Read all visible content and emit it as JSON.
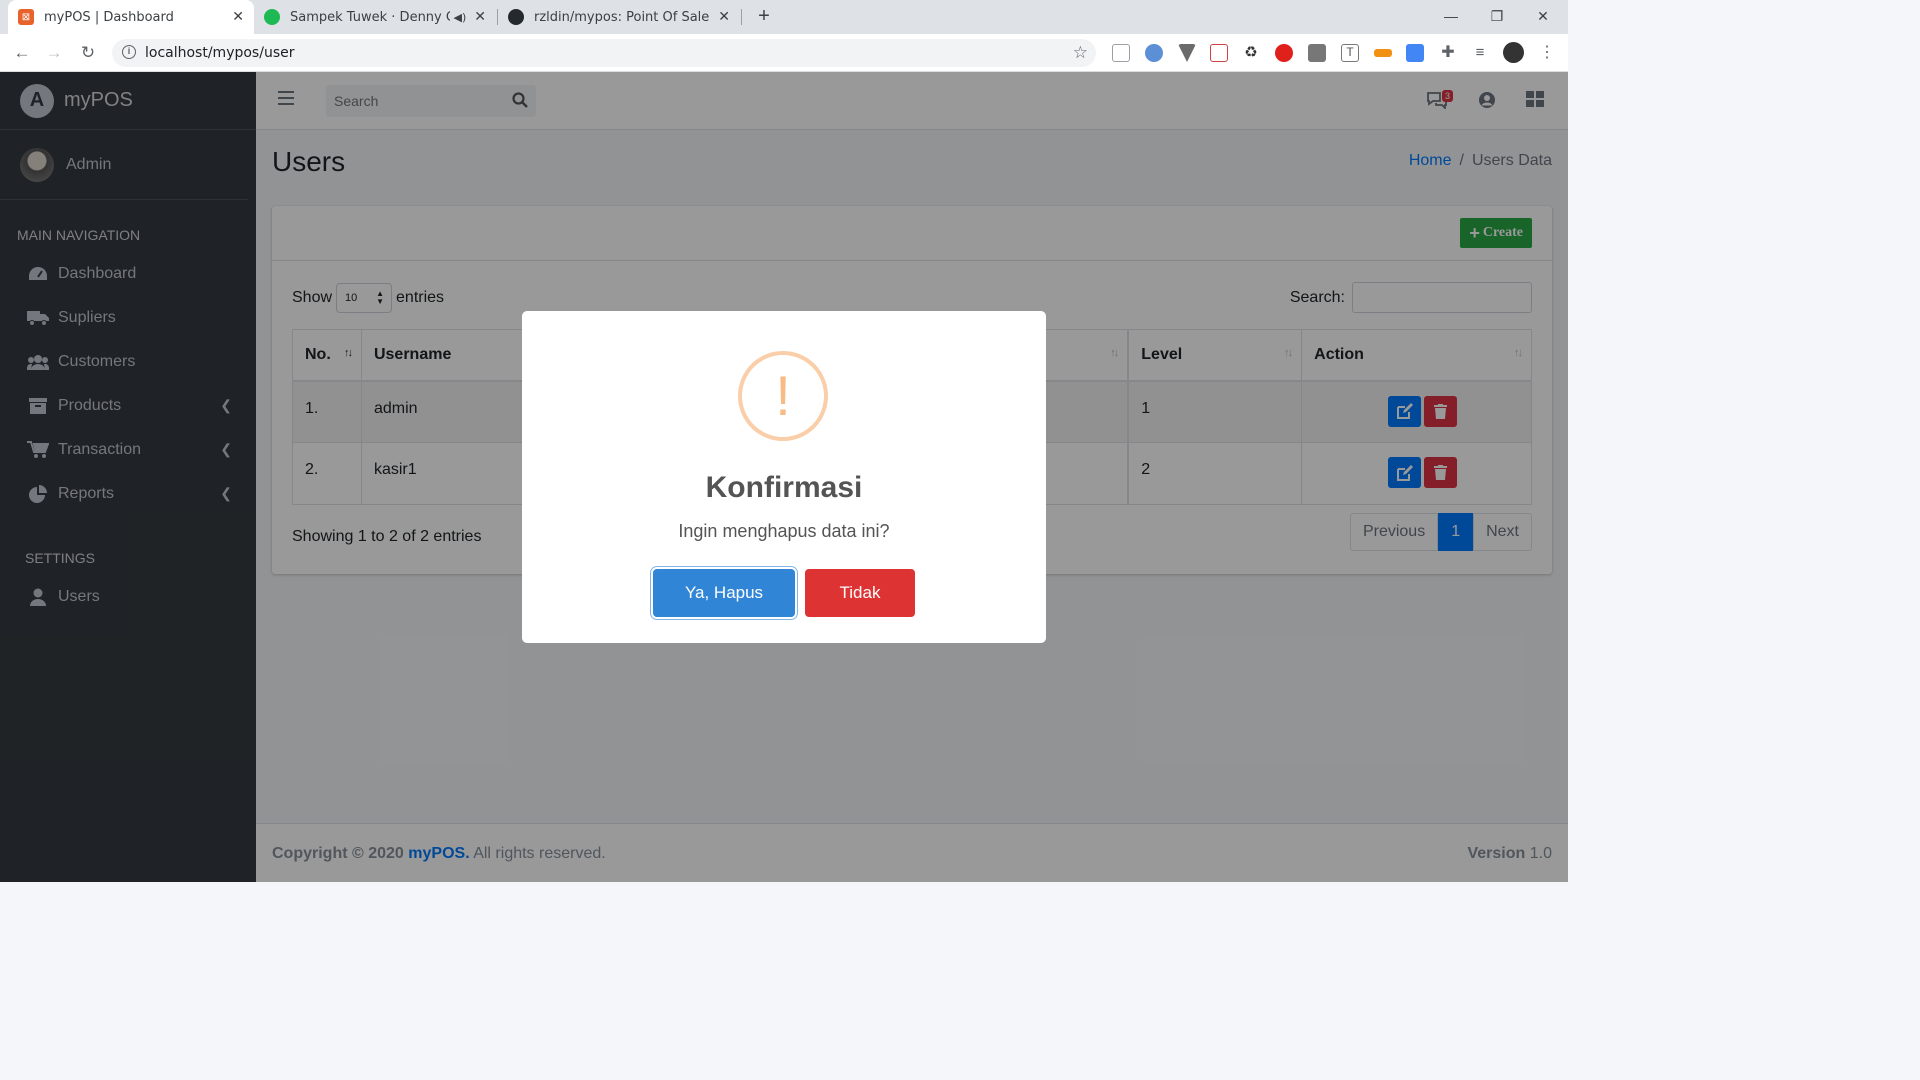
{
  "browser": {
    "tabs": [
      {
        "title": "myPOS | Dashboard",
        "active": true
      },
      {
        "title": "Sampek Tuwek · Denny Cakn",
        "active": false
      },
      {
        "title": "rzldin/mypos: Point Of Sale Appli",
        "active": false
      }
    ],
    "url": "localhost/mypos/user"
  },
  "sidebar": {
    "brand": "myPOS",
    "user": "Admin",
    "main_header": "MAIN NAVIGATION",
    "settings_header": "SETTINGS",
    "items": [
      {
        "label": "Dashboard",
        "icon": "tachometer-icon"
      },
      {
        "label": "Supliers",
        "icon": "truck-icon"
      },
      {
        "label": "Customers",
        "icon": "users-icon"
      },
      {
        "label": "Products",
        "icon": "archive-icon"
      },
      {
        "label": "Transaction",
        "icon": "cart-icon"
      },
      {
        "label": "Reports",
        "icon": "pie-chart-icon"
      }
    ],
    "settings_items": [
      {
        "label": "Users",
        "icon": "user-icon"
      }
    ]
  },
  "header": {
    "search_placeholder": "Search",
    "messages_badge": "3"
  },
  "page": {
    "title": "Users",
    "breadcrumb": {
      "home": "Home",
      "current": "Users Data"
    }
  },
  "card": {
    "create_label": "Create",
    "show_label": "Show",
    "entries_value": "10",
    "entries_label": "entries",
    "search_label": "Search:",
    "columns": [
      "No.",
      "Username",
      "",
      "Level",
      "Action"
    ],
    "rows": [
      {
        "no": "1.",
        "username": "admin",
        "level": "1"
      },
      {
        "no": "2.",
        "username": "kasir1",
        "level": "2"
      }
    ],
    "showing": "Showing 1 to 2 of 2 entries",
    "pager": {
      "previous": "Previous",
      "current": "1",
      "next": "Next"
    }
  },
  "footer": {
    "copyright_prefix": "Copyright © 2020",
    "brand": "myPOS.",
    "suffix": "All rights reserved.",
    "version_label": "Version",
    "version": "1.0"
  },
  "modal": {
    "icon": "!",
    "title": "Konfirmasi",
    "text": "Ingin menghapus data ini?",
    "confirm_label": "Ya, Hapus",
    "cancel_label": "Tidak"
  },
  "colors": {
    "sidebar": "#343a40",
    "primary": "#007bff",
    "success": "#28a745",
    "danger": "#dc3545",
    "confirm": "#3085d6",
    "cancel": "#dd3333",
    "warning_icon": "#f8bb86"
  }
}
